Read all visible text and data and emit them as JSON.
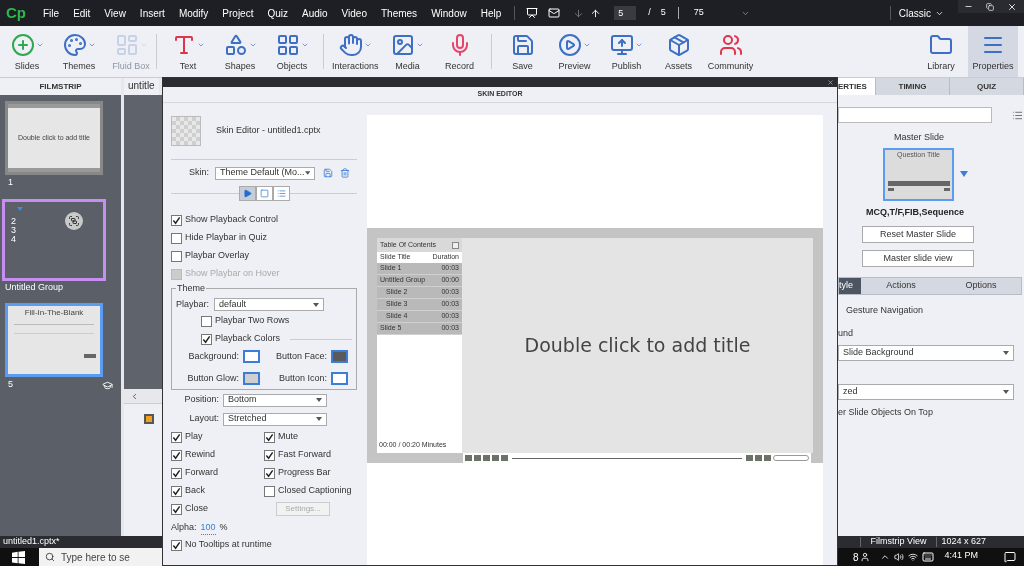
{
  "app": {
    "logo": "Cp",
    "menu": [
      "File",
      "Edit",
      "View",
      "Insert",
      "Modify",
      "Project",
      "Quiz",
      "Audio",
      "Video",
      "Themes",
      "Window",
      "Help"
    ],
    "page": {
      "current": "5",
      "separator": "/",
      "total": "5"
    },
    "zoom": "75",
    "workspace": "Classic"
  },
  "toolbar": [
    [
      {
        "kind": "slides",
        "label": "Slides",
        "menu": true,
        "disabled": false,
        "selected": false
      },
      {
        "kind": "themes",
        "label": "Themes",
        "menu": true,
        "disabled": false,
        "selected": false
      },
      {
        "kind": "fluid",
        "label": "Fluid Box",
        "menu": true,
        "disabled": true,
        "selected": false
      }
    ],
    [
      {
        "kind": "text",
        "label": "Text",
        "menu": true,
        "disabled": false,
        "selected": false
      },
      {
        "kind": "shapes",
        "label": "Shapes",
        "menu": true,
        "disabled": false,
        "selected": false
      },
      {
        "kind": "objects",
        "label": "Objects",
        "menu": true,
        "disabled": false,
        "selected": false
      }
    ],
    [
      {
        "kind": "interactions",
        "label": "Interactions",
        "menu": true,
        "disabled": false,
        "selected": false
      },
      {
        "kind": "media",
        "label": "Media",
        "menu": true,
        "disabled": false,
        "selected": false
      },
      {
        "kind": "record",
        "label": "Record",
        "menu": false,
        "disabled": false,
        "selected": false
      }
    ],
    [
      {
        "kind": "save",
        "label": "Save",
        "menu": false,
        "disabled": false,
        "selected": false
      },
      {
        "kind": "preview",
        "label": "Preview",
        "menu": true,
        "disabled": false,
        "selected": false
      },
      {
        "kind": "publish",
        "label": "Publish",
        "menu": true,
        "disabled": false,
        "selected": false
      },
      {
        "kind": "assets",
        "label": "Assets",
        "menu": false,
        "disabled": false,
        "selected": false
      },
      {
        "kind": "community",
        "label": "Community",
        "menu": false,
        "disabled": false,
        "selected": false
      }
    ],
    [
      {
        "kind": "library",
        "label": "Library",
        "menu": false,
        "disabled": false,
        "selected": false
      },
      {
        "kind": "properties",
        "label": "Properties",
        "menu": false,
        "disabled": false,
        "selected": true
      }
    ]
  ],
  "filmstrip": {
    "title": "FILMSTRIP",
    "slides": [
      {
        "kind": "slide",
        "number": "1",
        "thumb_text": "Double click to add title",
        "selected": false
      },
      {
        "kind": "group",
        "numbers": [
          "2",
          "3",
          "4"
        ],
        "name": "Untitled Group",
        "selected": false
      },
      {
        "kind": "quiz",
        "number": "5",
        "thumb_text": "Fill-In-The-Blank",
        "selected": true
      }
    ]
  },
  "stage": {
    "tab": "untitle"
  },
  "skin_editor": {
    "heading": "SKIN EDITOR",
    "skin_name": "Skin Editor - untitled1.cptx",
    "skin": {
      "label": "Skin:",
      "value": "Theme Default (Mo..."
    },
    "view_tabs": [
      {
        "kind": "playback",
        "selected": true
      },
      {
        "kind": "borders",
        "selected": false
      },
      {
        "kind": "toc",
        "selected": false
      }
    ],
    "options": [
      {
        "label": "Show Playback Control",
        "checked": true,
        "disabled": false
      },
      {
        "label": "Hide Playbar in Quiz",
        "checked": false,
        "disabled": false
      },
      {
        "label": "Playbar Overlay",
        "checked": false,
        "disabled": false
      },
      {
        "label": "Show Playbar on Hover",
        "checked": false,
        "disabled": true
      }
    ],
    "theme": {
      "legend": "Theme",
      "playbar": {
        "label": "Playbar:",
        "value": "default"
      },
      "two_rows": {
        "label": "Playbar Two Rows",
        "checked": false
      },
      "playback_colors": {
        "label": "Playback Colors",
        "checked": true
      },
      "colors": [
        {
          "label": "Background:",
          "color": "#ffffff"
        },
        {
          "label": "Button Face:",
          "color": "#5a5a5a"
        },
        {
          "label": "Button Glow:",
          "color": "#cfcfcf"
        },
        {
          "label": "Button Icon:",
          "color": "#ffffff"
        }
      ]
    },
    "position": {
      "label": "Position:",
      "value": "Bottom"
    },
    "layout": {
      "label": "Layout:",
      "value": "Stretched"
    },
    "controls": [
      {
        "label": "Play",
        "checked": true
      },
      {
        "label": "Mute",
        "checked": true
      },
      {
        "label": "Rewind",
        "checked": true
      },
      {
        "label": "Fast Forward",
        "checked": true
      },
      {
        "label": "Forward",
        "checked": true
      },
      {
        "label": "Progress Bar",
        "checked": true
      },
      {
        "label": "Back",
        "checked": true
      },
      {
        "label": "Closed Captioning",
        "checked": false
      },
      {
        "label": "Close",
        "checked": true
      }
    ],
    "settings_button": {
      "label": "Settings...",
      "disabled": true
    },
    "alpha": {
      "label": "Alpha:",
      "value": "100",
      "unit": "%"
    },
    "no_tooltips": {
      "label": "No Tooltips at runtime",
      "checked": true
    },
    "preview": {
      "toc": {
        "title": "Table Of Contents",
        "columns": [
          "Slide Title",
          "Duration"
        ],
        "rows": [
          {
            "title": "Slide 1",
            "duration": "00:03"
          },
          {
            "title": "Untitled Group",
            "duration": "00:00",
            "children": [
              {
                "title": "Slide 2",
                "duration": "00:03"
              },
              {
                "title": "Slide 3",
                "duration": "00:03"
              },
              {
                "title": "Slide 4",
                "duration": "00:03"
              }
            ]
          },
          {
            "title": "Slide 5",
            "duration": "00:03"
          }
        ],
        "footer": "00:00 / 00:20 Minutes"
      },
      "slide_title": "Double click to add title"
    }
  },
  "properties": {
    "tabs": [
      {
        "label": "ERTIES",
        "selected": true
      },
      {
        "label": "TIMING",
        "selected": false
      },
      {
        "label": "QUIZ",
        "selected": false
      }
    ],
    "master_slide": {
      "label": "Master Slide",
      "thumb_title": "Question Title",
      "name": "MCQ,T/F,FIB,Sequence"
    },
    "buttons": [
      "Reset Master Slide",
      "Master slide view"
    ],
    "sub_tabs": [
      {
        "label": "tyle",
        "selected": true
      },
      {
        "label": "Actions",
        "selected": false
      },
      {
        "label": "Options",
        "selected": false
      }
    ],
    "gesture": "Gesture Navigation",
    "background_label": "und",
    "background_value": "Slide Background",
    "scale_value": "zed",
    "objects_on_top": "er Slide Objects On Top"
  },
  "status_bar": {
    "file": "untitled1.cptx*",
    "view": "Filmstrip View",
    "size": "1024 x 627"
  },
  "taskbar": {
    "search": "Type here to se",
    "time": "4:41 PM",
    "partial_text": "8"
  }
}
